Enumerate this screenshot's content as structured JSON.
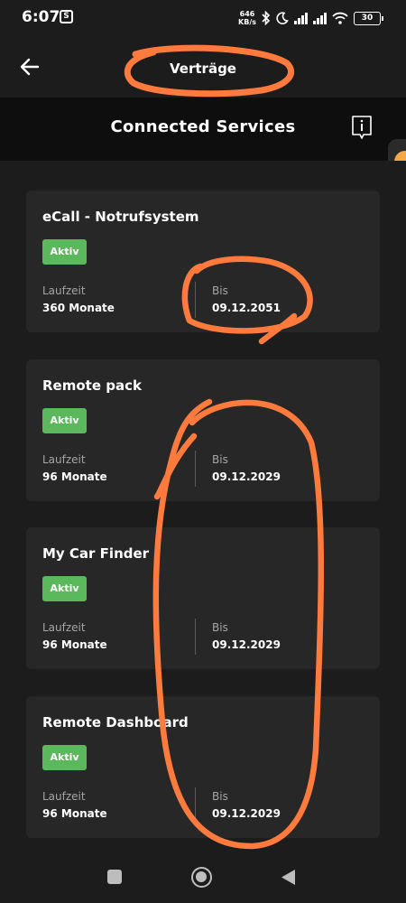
{
  "status_bar": {
    "time": "6:07",
    "net_speed_value": "646",
    "net_speed_unit": "KB/s",
    "battery": "30",
    "app_icon": "S"
  },
  "header": {
    "title": "Verträge"
  },
  "section": {
    "title": "Connected Services"
  },
  "services": [
    {
      "name": "eCall - Notrufsystem",
      "status": "Aktiv",
      "duration_label": "Laufzeit",
      "duration": "360 Monate",
      "until_label": "Bis",
      "until": "09.12.2051"
    },
    {
      "name": "Remote pack",
      "status": "Aktiv",
      "duration_label": "Laufzeit",
      "duration": "96 Monate",
      "until_label": "Bis",
      "until": "09.12.2029"
    },
    {
      "name": "My Car Finder",
      "status": "Aktiv",
      "duration_label": "Laufzeit",
      "duration": "96 Monate",
      "until_label": "Bis",
      "until": "09.12.2029"
    },
    {
      "name": "Remote Dashboard",
      "status": "Aktiv",
      "duration_label": "Laufzeit",
      "duration": "96 Monate",
      "until_label": "Bis",
      "until": "09.12.2029"
    }
  ],
  "colors": {
    "background": "#1c1c1c",
    "card": "#272727",
    "badge": "#5cb85c",
    "annotation": "#ff7a3d",
    "side_tab_dot": "#f4a847"
  },
  "icons": {
    "back": "arrow-left-icon",
    "info": "info-icon",
    "nav_recents": "square-icon",
    "nav_home": "circle-icon",
    "nav_back": "triangle-back-icon"
  }
}
